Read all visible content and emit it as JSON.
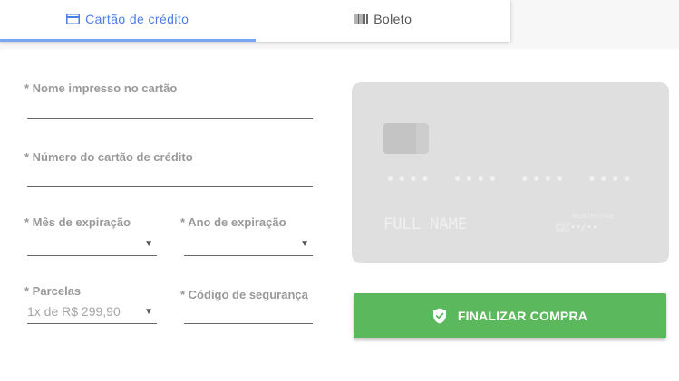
{
  "tabs": {
    "credit_card": {
      "label": "Cartão de crédito",
      "icon": "credit-card-icon"
    },
    "boleto": {
      "label": "Boleto",
      "icon": "barcode-icon"
    }
  },
  "form": {
    "card_name_label": "* Nome impresso no cartão",
    "card_number_label": "* Número do cartão de crédito",
    "exp_month_label": "* Mês de expiração",
    "exp_year_label": "* Ano de expiração",
    "installments_label": "* Parcelas",
    "installments_value": "1x de R$ 299,90",
    "security_code_label": "* Código de segurança"
  },
  "card_preview": {
    "number": "•••• •••• •••• ••••",
    "name": "FULL NAME",
    "valid_label": "MONTH/YEAR",
    "valid_prefix": "VALID THRU",
    "expiry": "••/••"
  },
  "submit": {
    "label": "FINALIZAR COMPRA",
    "icon": "shield-check-icon"
  },
  "colors": {
    "accent": "#4a7ee8",
    "tab_indicator": "#7ba6f2",
    "button": "#5cb85c",
    "card_bg": "#e0dfe0",
    "label": "#999999"
  }
}
